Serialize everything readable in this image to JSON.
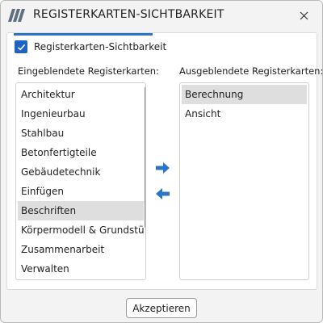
{
  "window": {
    "title": "REGISTERKARTEN-SICHTBARKEIT"
  },
  "checkbox": {
    "label": "Registerkarten-Sichtbarkeit",
    "checked": true
  },
  "visible_list": {
    "caption": "Eingeblendete Registerkarten:",
    "items": [
      "Architektur",
      "Ingenieurbau",
      "Stahlbau",
      "Betonfertigteile",
      "Gebäudetechnik",
      "Einfügen",
      "Beschriften",
      "Körpermodell & Grundstü",
      "Zusammenarbeit",
      "Verwalten"
    ],
    "selected": "Beschriften"
  },
  "hidden_list": {
    "caption": "Ausgeblendete Registerkarten:",
    "items": [
      "Berechnung",
      "Ansicht"
    ],
    "selected": "Berechnung"
  },
  "footer": {
    "accept_label": "Akzeptieren"
  },
  "colors": {
    "accent": "#2a75c9",
    "arrow": "#2a75c9",
    "checkbox": "#1f63c2",
    "selection": "#dedede"
  },
  "icons": {
    "logo": "app-logo-icon",
    "close": "close-icon",
    "move_right": "arrow-right-icon",
    "move_left": "arrow-left-icon",
    "checkmark": "checkmark-icon"
  }
}
